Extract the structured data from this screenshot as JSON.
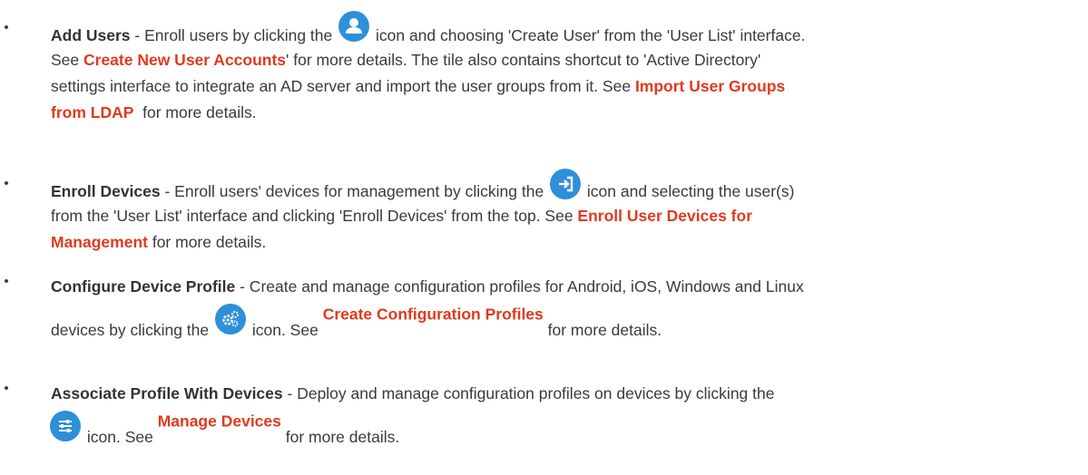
{
  "items": [
    {
      "term": "Add Users",
      "t1": " - Enroll users by clicking the ",
      "icon": "user-icon",
      "t2": " icon and choosing 'Create User' from the 'User List' interface.",
      "t3": "See ",
      "link1": "Create New User Accounts",
      "t4": "' for more details. The tile also contains shortcut to 'Active Directory'",
      "t5": "settings interface to integrate an AD server and import the user groups from it. See ",
      "link2a": "Import User Groups",
      "link2b": "from LDAP",
      "t6": "  for more details."
    },
    {
      "term": "Enroll Devices",
      "t1": " - Enroll users' devices for management by clicking the ",
      "icon": "enroll-device-icon",
      "t2": " icon and selecting the user(s)",
      "t3": "from the 'User List' interface and clicking 'Enroll Devices' from the top. See ",
      "link1a": "Enroll User Devices for",
      "link1b": "Management",
      "t4": " for more details."
    },
    {
      "term": "Configure Device Profile",
      "t1": " - Create and manage configuration profiles for Android, iOS, Windows and Linux",
      "t2": "devices by clicking the ",
      "icon": "gears-icon",
      "t3": " icon. See ",
      "link1": "Create Configuration Profiles",
      "t4": " for more details."
    },
    {
      "term": "Associate Profile With Devices",
      "t1": " - Deploy and manage configuration profiles on devices by clicking the",
      "icon": "sliders-icon",
      "t2": " icon. See ",
      "link1": "Manage Devices",
      "t3": " for more details."
    }
  ],
  "bullet": "•",
  "colors": {
    "text": "#3a3a3a",
    "link": "#e03a1e",
    "icon_bg": "#2f8fd8"
  }
}
